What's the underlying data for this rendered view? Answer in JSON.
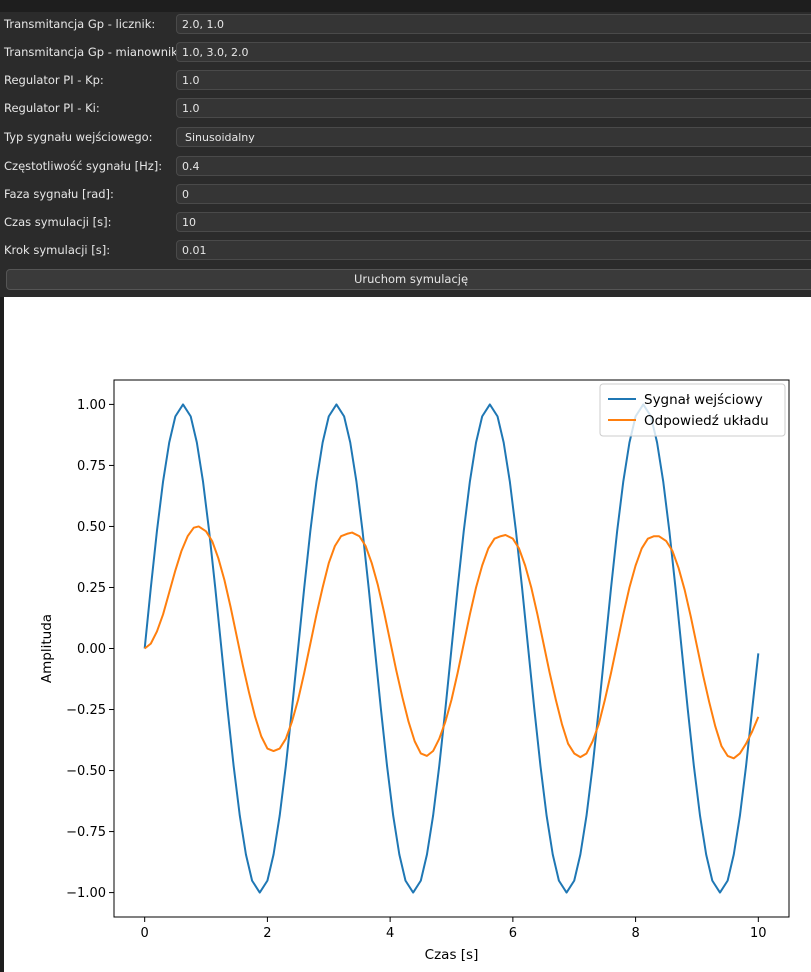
{
  "form": {
    "rows": [
      {
        "label": "Transmitancja Gp - licznik:",
        "value": "2.0, 1.0"
      },
      {
        "label": "Transmitancja Gp - mianownik:",
        "value": "1.0, 3.0, 2.0"
      },
      {
        "label": "Regulator PI - Kp:",
        "value": "1.0"
      },
      {
        "label": "Regulator PI - Ki:",
        "value": "1.0"
      },
      {
        "label": "Typ sygnału wejściowego:",
        "value": "Sinusoidalny"
      },
      {
        "label": "Częstotliwość sygnału [Hz]:",
        "value": "0.4"
      },
      {
        "label": "Faza sygnału [rad]:",
        "value": "0"
      },
      {
        "label": "Czas symulacji [s]:",
        "value": "10"
      },
      {
        "label": "Krok symulacji [s]:",
        "value": "0.01"
      }
    ],
    "run_button": "Uruchom symulację"
  },
  "chart_data": {
    "type": "line",
    "xlabel": "Czas [s]",
    "ylabel": "Amplituda",
    "xlim": [
      -0.5,
      10.5
    ],
    "ylim": [
      -1.1,
      1.1
    ],
    "xticks": [
      "0",
      "2",
      "4",
      "6",
      "8",
      "10"
    ],
    "yticks": [
      "1.00",
      "0.75",
      "0.50",
      "0.25",
      "0.00",
      "−0.25",
      "−0.50",
      "−0.75",
      "−1.00"
    ],
    "legend_position": "top-right",
    "grid": false,
    "series": [
      {
        "name": "Sygnał wejściowy",
        "color": "#1f77b4",
        "x": [
          0,
          0.1,
          0.2,
          0.3,
          0.4,
          0.5,
          0.625,
          0.75,
          0.85,
          0.95,
          1.05,
          1.15,
          1.25,
          1.35,
          1.45,
          1.55,
          1.65,
          1.75,
          1.875,
          2.0,
          2.1,
          2.2,
          2.3,
          2.4,
          2.5,
          2.6,
          2.7,
          2.8,
          2.9,
          3.0,
          3.125,
          3.25,
          3.35,
          3.45,
          3.55,
          3.65,
          3.75,
          3.85,
          3.95,
          4.05,
          4.15,
          4.25,
          4.375,
          4.5,
          4.6,
          4.7,
          4.8,
          4.9,
          5.0,
          5.1,
          5.2,
          5.3,
          5.4,
          5.5,
          5.625,
          5.75,
          5.85,
          5.95,
          6.05,
          6.15,
          6.25,
          6.35,
          6.45,
          6.55,
          6.65,
          6.75,
          6.875,
          7.0,
          7.1,
          7.2,
          7.3,
          7.4,
          7.5,
          7.6,
          7.7,
          7.8,
          7.9,
          8.0,
          8.125,
          8.25,
          8.35,
          8.45,
          8.55,
          8.65,
          8.75,
          8.85,
          8.95,
          9.05,
          9.15,
          9.25,
          9.375,
          9.5,
          9.6,
          9.7,
          9.8,
          9.9,
          10.0
        ],
        "y": [
          0.0,
          0.249,
          0.482,
          0.685,
          0.844,
          0.951,
          1.0,
          0.951,
          0.844,
          0.685,
          0.482,
          0.249,
          0.0,
          -0.249,
          -0.482,
          -0.685,
          -0.844,
          -0.951,
          -1.0,
          -0.951,
          -0.844,
          -0.685,
          -0.482,
          -0.249,
          0.0,
          0.249,
          0.482,
          0.685,
          0.844,
          0.951,
          1.0,
          0.951,
          0.844,
          0.685,
          0.482,
          0.249,
          0.0,
          -0.249,
          -0.482,
          -0.685,
          -0.844,
          -0.951,
          -1.0,
          -0.951,
          -0.844,
          -0.685,
          -0.482,
          -0.249,
          0.0,
          0.249,
          0.482,
          0.685,
          0.844,
          0.951,
          1.0,
          0.951,
          0.844,
          0.685,
          0.482,
          0.249,
          0.0,
          -0.249,
          -0.482,
          -0.685,
          -0.844,
          -0.951,
          -1.0,
          -0.951,
          -0.844,
          -0.685,
          -0.482,
          -0.249,
          0.0,
          0.249,
          0.482,
          0.685,
          0.844,
          0.951,
          1.0,
          0.951,
          0.844,
          0.685,
          0.482,
          0.249,
          0.0,
          -0.249,
          -0.482,
          -0.685,
          -0.844,
          -0.951,
          -1.0,
          -0.951,
          -0.844,
          -0.685,
          -0.482,
          -0.249,
          -0.02
        ]
      },
      {
        "name": "Odpowiedź układu",
        "color": "#ff7f0e",
        "x": [
          0,
          0.1,
          0.2,
          0.3,
          0.4,
          0.5,
          0.6,
          0.7,
          0.8,
          0.88,
          1.0,
          1.1,
          1.2,
          1.3,
          1.4,
          1.5,
          1.6,
          1.7,
          1.8,
          1.9,
          2.0,
          2.1,
          2.2,
          2.3,
          2.4,
          2.5,
          2.6,
          2.7,
          2.8,
          2.9,
          3.0,
          3.1,
          3.2,
          3.3,
          3.38,
          3.5,
          3.6,
          3.7,
          3.8,
          3.9,
          4.0,
          4.1,
          4.2,
          4.3,
          4.4,
          4.5,
          4.6,
          4.7,
          4.8,
          4.9,
          5.0,
          5.1,
          5.2,
          5.3,
          5.4,
          5.5,
          5.6,
          5.7,
          5.8,
          5.88,
          6.0,
          6.1,
          6.2,
          6.3,
          6.4,
          6.5,
          6.6,
          6.7,
          6.8,
          6.9,
          7.0,
          7.1,
          7.2,
          7.3,
          7.4,
          7.5,
          7.6,
          7.7,
          7.8,
          7.9,
          8.0,
          8.1,
          8.2,
          8.3,
          8.38,
          8.5,
          8.6,
          8.7,
          8.8,
          8.9,
          9.0,
          9.1,
          9.2,
          9.3,
          9.4,
          9.5,
          9.6,
          9.7,
          9.8,
          9.9,
          10.0
        ],
        "y": [
          0.0,
          0.02,
          0.07,
          0.14,
          0.23,
          0.32,
          0.4,
          0.46,
          0.495,
          0.5,
          0.48,
          0.44,
          0.37,
          0.28,
          0.17,
          0.05,
          -0.07,
          -0.18,
          -0.28,
          -0.36,
          -0.41,
          -0.42,
          -0.41,
          -0.37,
          -0.3,
          -0.21,
          -0.1,
          0.02,
          0.14,
          0.25,
          0.35,
          0.42,
          0.46,
          0.47,
          0.475,
          0.46,
          0.42,
          0.35,
          0.26,
          0.15,
          0.03,
          -0.09,
          -0.2,
          -0.3,
          -0.38,
          -0.43,
          -0.44,
          -0.42,
          -0.37,
          -0.3,
          -0.21,
          -0.1,
          0.02,
          0.14,
          0.25,
          0.34,
          0.41,
          0.45,
          0.46,
          0.465,
          0.45,
          0.41,
          0.34,
          0.25,
          0.14,
          0.02,
          -0.1,
          -0.21,
          -0.31,
          -0.39,
          -0.43,
          -0.445,
          -0.43,
          -0.38,
          -0.31,
          -0.21,
          -0.1,
          0.02,
          0.14,
          0.25,
          0.34,
          0.41,
          0.45,
          0.46,
          0.46,
          0.44,
          0.4,
          0.33,
          0.24,
          0.13,
          0.01,
          -0.11,
          -0.22,
          -0.32,
          -0.4,
          -0.44,
          -0.45,
          -0.43,
          -0.39,
          -0.34,
          -0.28
        ]
      }
    ]
  }
}
